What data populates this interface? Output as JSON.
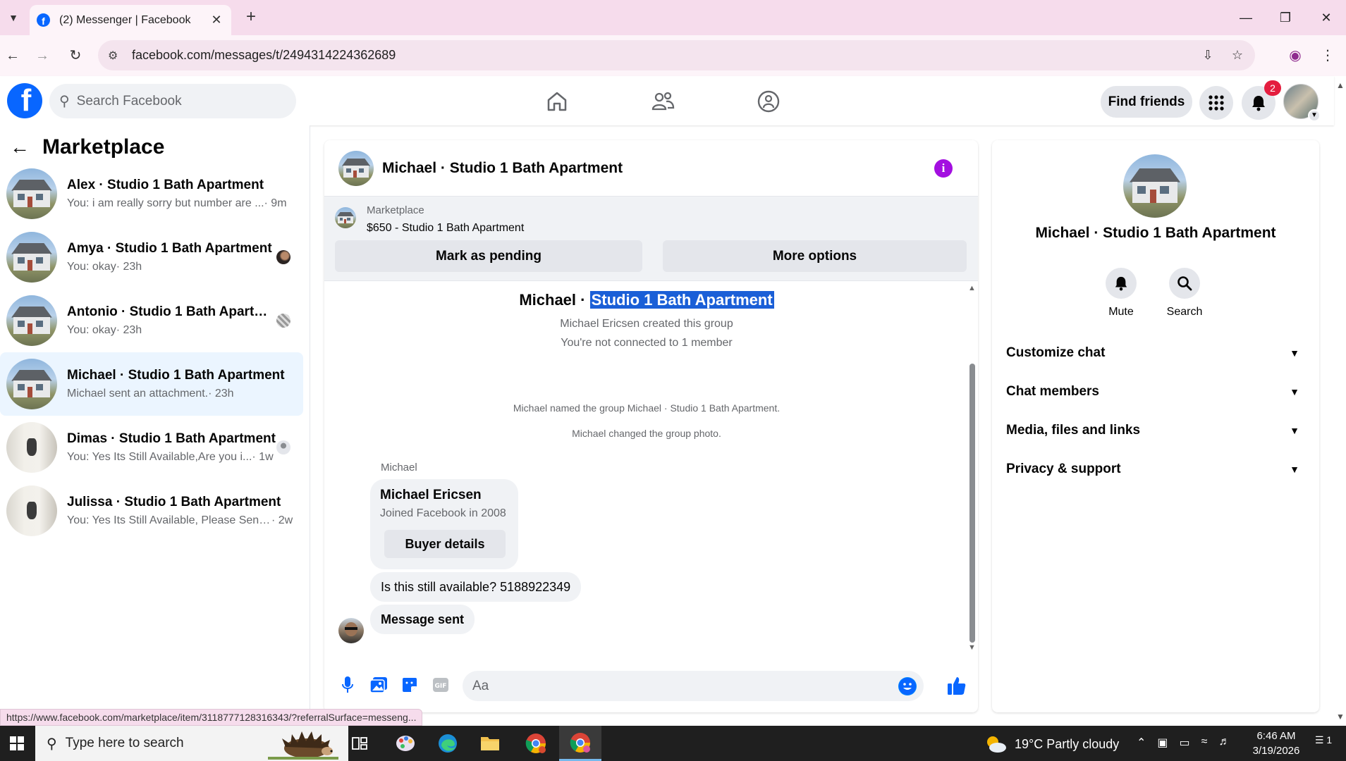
{
  "browser": {
    "tab_title": "(2) Messenger | Facebook",
    "url": "facebook.com/messages/t/2494314224362689",
    "status_url": "https://www.facebook.com/marketplace/item/3118777128316343/?referralSurface=messeng..."
  },
  "fb_header": {
    "search_placeholder": "Search Facebook",
    "find_friends_label": "Find friends",
    "notification_count": "2",
    "logo_letter": "f"
  },
  "sidebar": {
    "title": "Marketplace",
    "conversations": [
      {
        "name": "Alex · Studio 1 Bath Apartment",
        "snippet": "You: i am really sorry but number are ...",
        "time": " · 9m",
        "active": false
      },
      {
        "name": "Amya · Studio 1 Bath Apartment",
        "snippet": "You: okay",
        "time": " · 23h",
        "active": false
      },
      {
        "name": "Antonio · Studio 1 Bath Apartme...",
        "snippet": "You: okay",
        "time": " · 23h",
        "active": false
      },
      {
        "name": "Michael · Studio 1 Bath Apartment",
        "snippet": "Michael sent an attachment.",
        "time": " · 23h",
        "active": true
      },
      {
        "name": "Dimas · Studio 1 Bath Apartment",
        "snippet": "You: Yes Its Still Available,Are you i...",
        "time": " · 1w",
        "active": false
      },
      {
        "name": "Julissa · Studio 1 Bath Apartment",
        "snippet": "You: Yes Its Still Available, Please Send...",
        "time": " · 2w",
        "active": false
      }
    ]
  },
  "chat": {
    "title": "Michael · Studio 1 Bath Apartment",
    "marketplace_label": "Marketplace",
    "listing": "$650 - Studio 1 Bath Apartment",
    "mark_pending_label": "Mark as pending",
    "more_options_label": "More options",
    "group_title_prefix": "Michael · ",
    "group_title_highlight": "Studio 1 Bath Apartment",
    "created_text": "Michael Ericsen created this group",
    "connected_text": "You're not connected to 1 member",
    "named_text": "Michael named the group Michael · Studio 1 Bath Apartment.",
    "photo_text": "Michael changed the group photo.",
    "sender_name": "Michael",
    "card_name": "Michael Ericsen",
    "card_sub": "Joined Facebook in 2008",
    "card_button": "Buyer details",
    "message_1": "Is this still available? 5188922349",
    "message_2": "Message sent",
    "composer_placeholder": "Aa"
  },
  "info_panel": {
    "title": "Michael · Studio 1 Bath Apartment",
    "mute_label": "Mute",
    "search_label": "Search",
    "sections": [
      "Customize chat",
      "Chat members",
      "Media, files and links",
      "Privacy & support"
    ]
  },
  "taskbar": {
    "search_placeholder": "Type here to search",
    "weather": "19°C  Partly cloudy",
    "time": "6:46 AM",
    "date": "3/19/2026",
    "notif_count": "1"
  },
  "colors": {
    "fb_blue": "#0866ff",
    "messenger_blue": "#0084ff",
    "active_conv": "#ebf5ff",
    "info_purple": "#a30fe0",
    "badge_red": "#e41e3f",
    "chrome_pink": "#f6dcec",
    "selection_blue": "#1a5fd7"
  },
  "icons": [
    "home-icon",
    "friends-icon",
    "groups-icon",
    "menu-grid-icon",
    "bell-icon",
    "microphone-icon",
    "image-icon",
    "sticker-icon",
    "gif-icon",
    "emoji-icon",
    "thumbs-up-icon"
  ]
}
